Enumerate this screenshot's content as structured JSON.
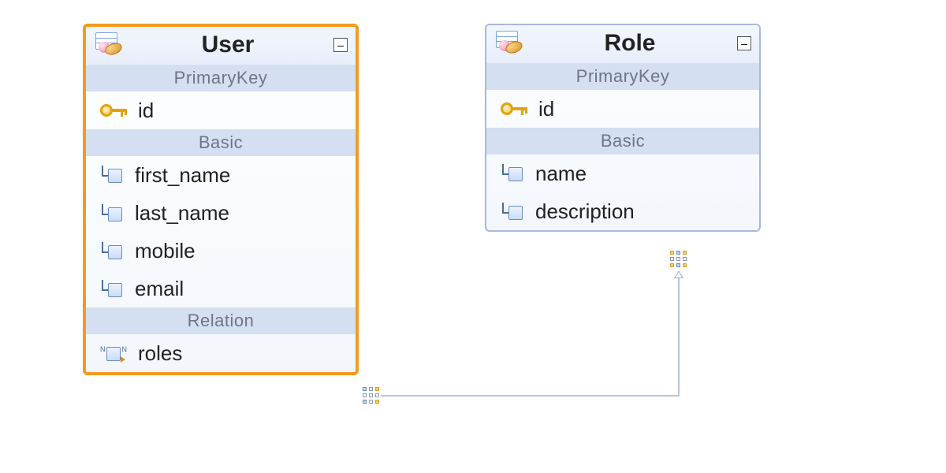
{
  "entities": {
    "user": {
      "title": "User",
      "selected": true,
      "sections": {
        "pk_label": "PrimaryKey",
        "basic_label": "Basic",
        "relation_label": "Relation"
      },
      "pk": [
        {
          "name": "id"
        }
      ],
      "basic": [
        {
          "name": "first_name"
        },
        {
          "name": "last_name"
        },
        {
          "name": "mobile"
        },
        {
          "name": "email"
        }
      ],
      "relation": [
        {
          "name": "roles"
        }
      ]
    },
    "role": {
      "title": "Role",
      "selected": false,
      "sections": {
        "pk_label": "PrimaryKey",
        "basic_label": "Basic"
      },
      "pk": [
        {
          "name": "id"
        }
      ],
      "basic": [
        {
          "name": "name"
        },
        {
          "name": "description"
        }
      ]
    }
  },
  "collapse_glyph": "–",
  "relationship": {
    "from": "user.roles",
    "to": "role",
    "type": "many-to-many"
  }
}
